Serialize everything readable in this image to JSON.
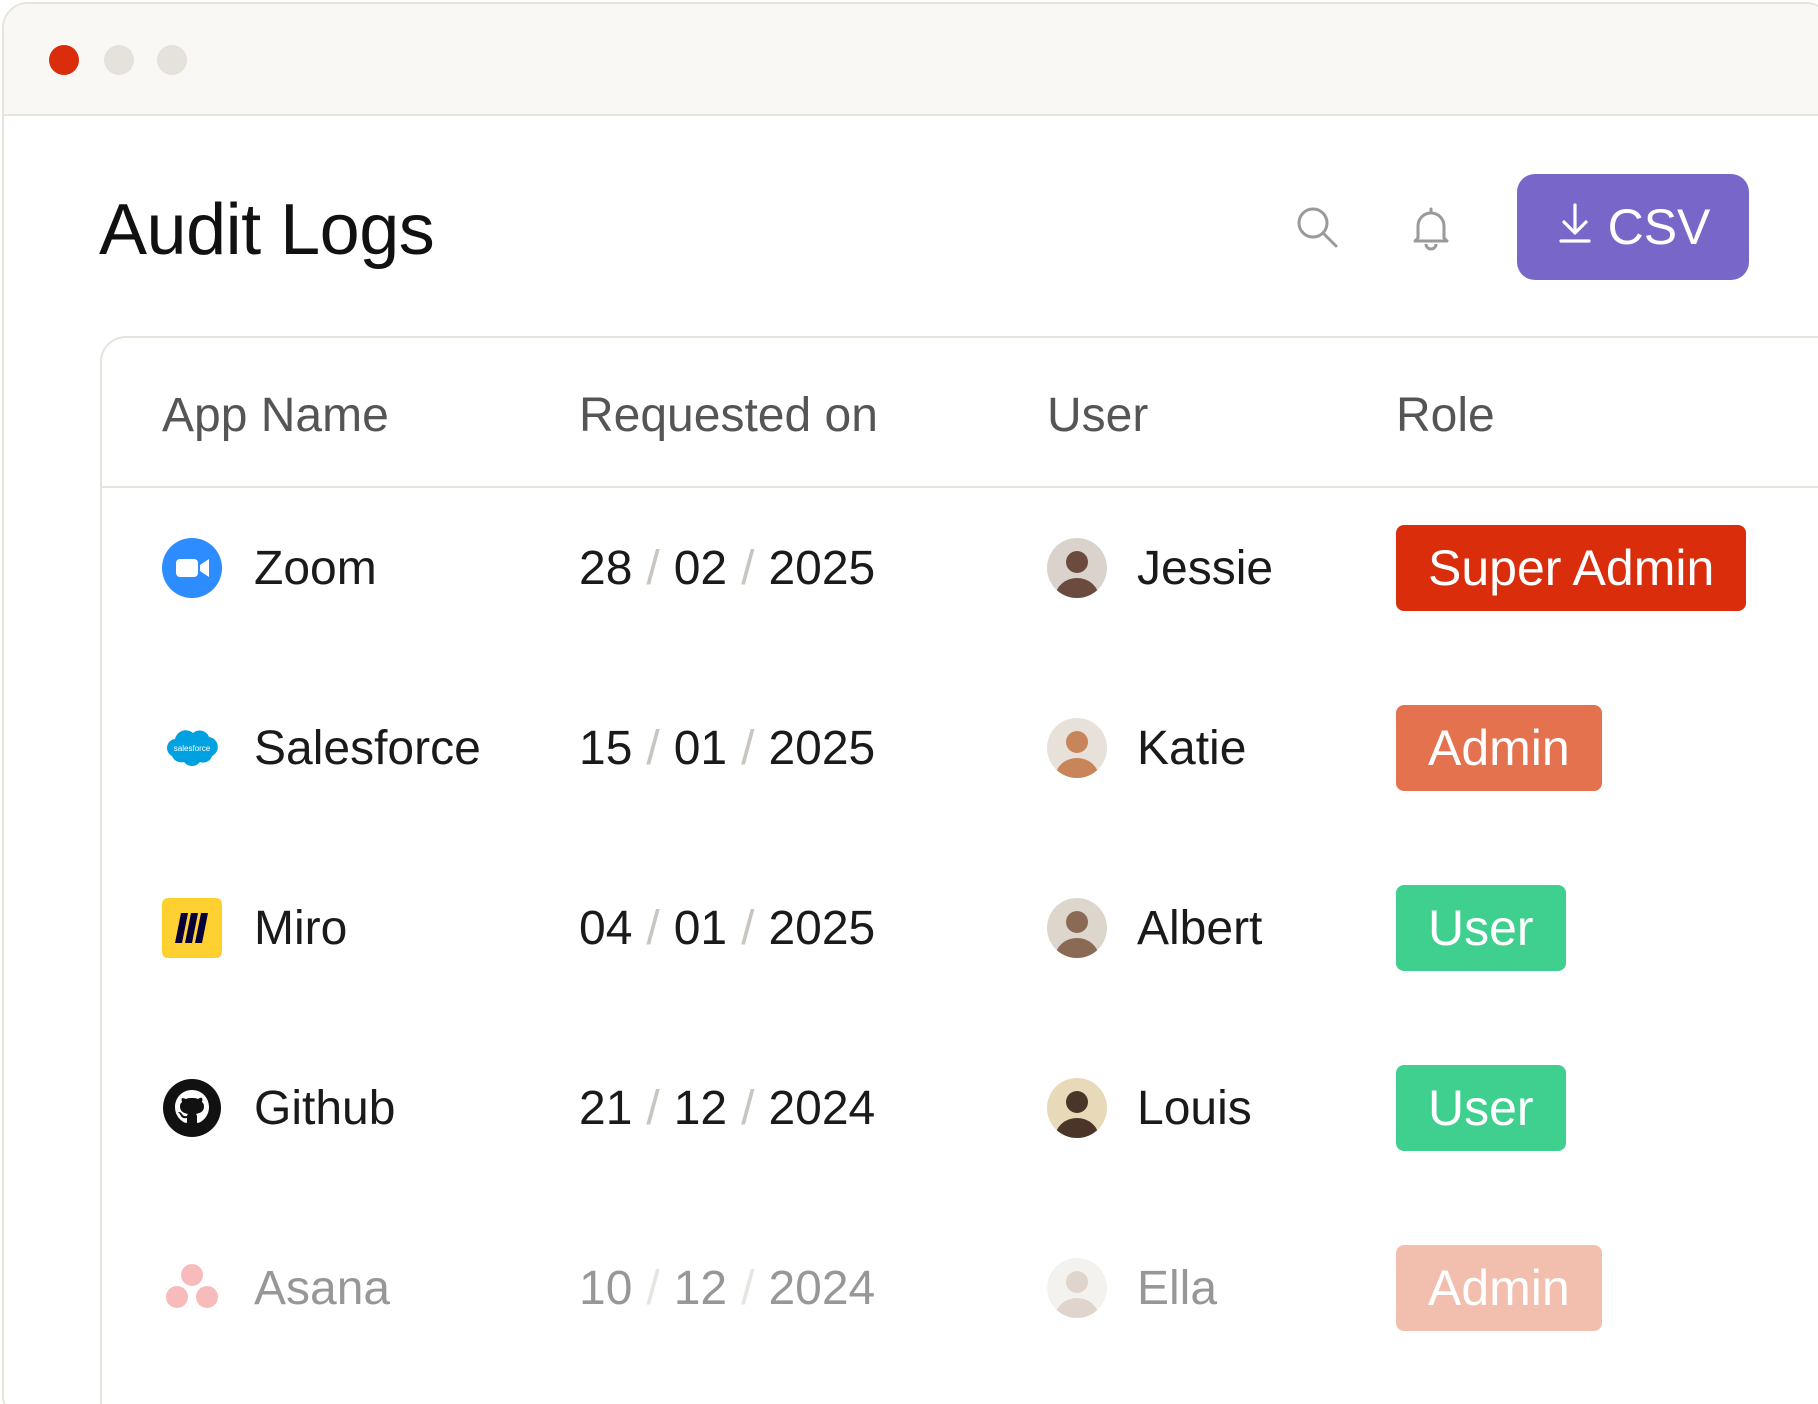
{
  "window": {
    "dots": [
      "close",
      "minimize",
      "maximize"
    ]
  },
  "header": {
    "title": "Audit Logs",
    "search_icon": "search-icon",
    "bell_icon": "bell-icon",
    "csv_button": "CSV"
  },
  "table": {
    "columns": [
      "App Name",
      "Requested on",
      "User",
      "Role"
    ],
    "rows": [
      {
        "app": "Zoom",
        "icon": "zoom-icon",
        "day": "28",
        "month": "02",
        "year": "2025",
        "user": "Jessie",
        "role": "Super Admin",
        "role_color": "#d92d0c",
        "faded": false
      },
      {
        "app": "Salesforce",
        "icon": "salesforce-icon",
        "day": "15",
        "month": "01",
        "year": "2025",
        "user": "Katie",
        "role": "Admin",
        "role_color": "#e4724f",
        "faded": false
      },
      {
        "app": "Miro",
        "icon": "miro-icon",
        "day": "04",
        "month": "01",
        "year": "2025",
        "user": "Albert",
        "role": "User",
        "role_color": "#3fcf8e",
        "faded": false
      },
      {
        "app": "Github",
        "icon": "github-icon",
        "day": "21",
        "month": "12",
        "year": "2024",
        "user": "Louis",
        "role": "User",
        "role_color": "#3fcf8e",
        "faded": false
      },
      {
        "app": "Asana",
        "icon": "asana-icon",
        "day": "10",
        "month": "12",
        "year": "2024",
        "user": "Ella",
        "role": "Admin",
        "role_color": "#e4724f",
        "faded": true
      }
    ],
    "date_separator": "/"
  },
  "colors": {
    "accent": "#7866c9",
    "close_dot": "#d92d0c"
  }
}
